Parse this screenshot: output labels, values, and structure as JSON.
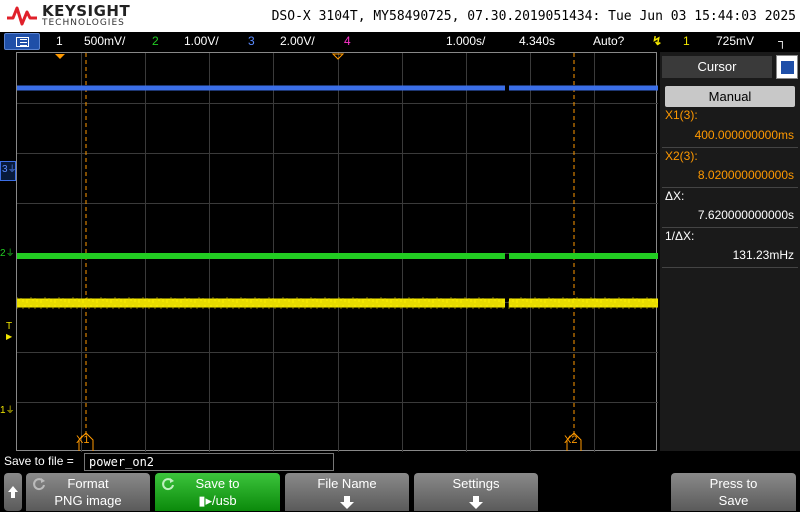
{
  "header": {
    "brand": "KEYSIGHT",
    "brand_sub": "TECHNOLOGIES",
    "scope_info": "DSO-X 3104T, MY58490725, 07.30.2019051434: Tue Jun 03 15:44:03 2025"
  },
  "channel_bar": {
    "ch1_num": "1",
    "ch1_scale": "500mV/",
    "ch2_num": "2",
    "ch2_scale": "1.00V/",
    "ch3_num": "3",
    "ch3_scale": "2.00V/",
    "ch4_num": "4",
    "timebase": "1.000s/",
    "delay": "4.340s",
    "trigger_mode": "Auto?",
    "trigger_source": "1",
    "trigger_level": "725mV",
    "colors": {
      "ch1": "#f2e600",
      "ch2": "#22cc22",
      "ch3": "#3b6ee6",
      "ch4": "#ff33cc",
      "cursor": "#ff9900"
    }
  },
  "display": {
    "markers": {
      "ch3": "3",
      "ch2": "2",
      "ch1": "1",
      "trigger": "T",
      "cursor_x1": "X1",
      "cursor_x2": "X2"
    }
  },
  "cursor_panel": {
    "title": "Cursor",
    "mode": "Manual",
    "x1_label": "X1(3):",
    "x1_value": "400.000000000ms",
    "x2_label": "X2(3):",
    "x2_value": "8.020000000000s",
    "dx_label": "ΔX:",
    "dx_value": "7.620000000000s",
    "inv_dx_label": "1/ΔX:",
    "inv_dx_value": "131.23mHz"
  },
  "save": {
    "label": "Save to file =",
    "filename": "power_on2"
  },
  "softkeys": {
    "format_l1": "Format",
    "format_l2": "PNG image",
    "saveto_l1": "Save to",
    "saveto_l2": "▮▸/usb",
    "filename_l1": "File Name",
    "settings_l1": "Settings",
    "press_l1": "Press to",
    "press_l2": "Save"
  }
}
